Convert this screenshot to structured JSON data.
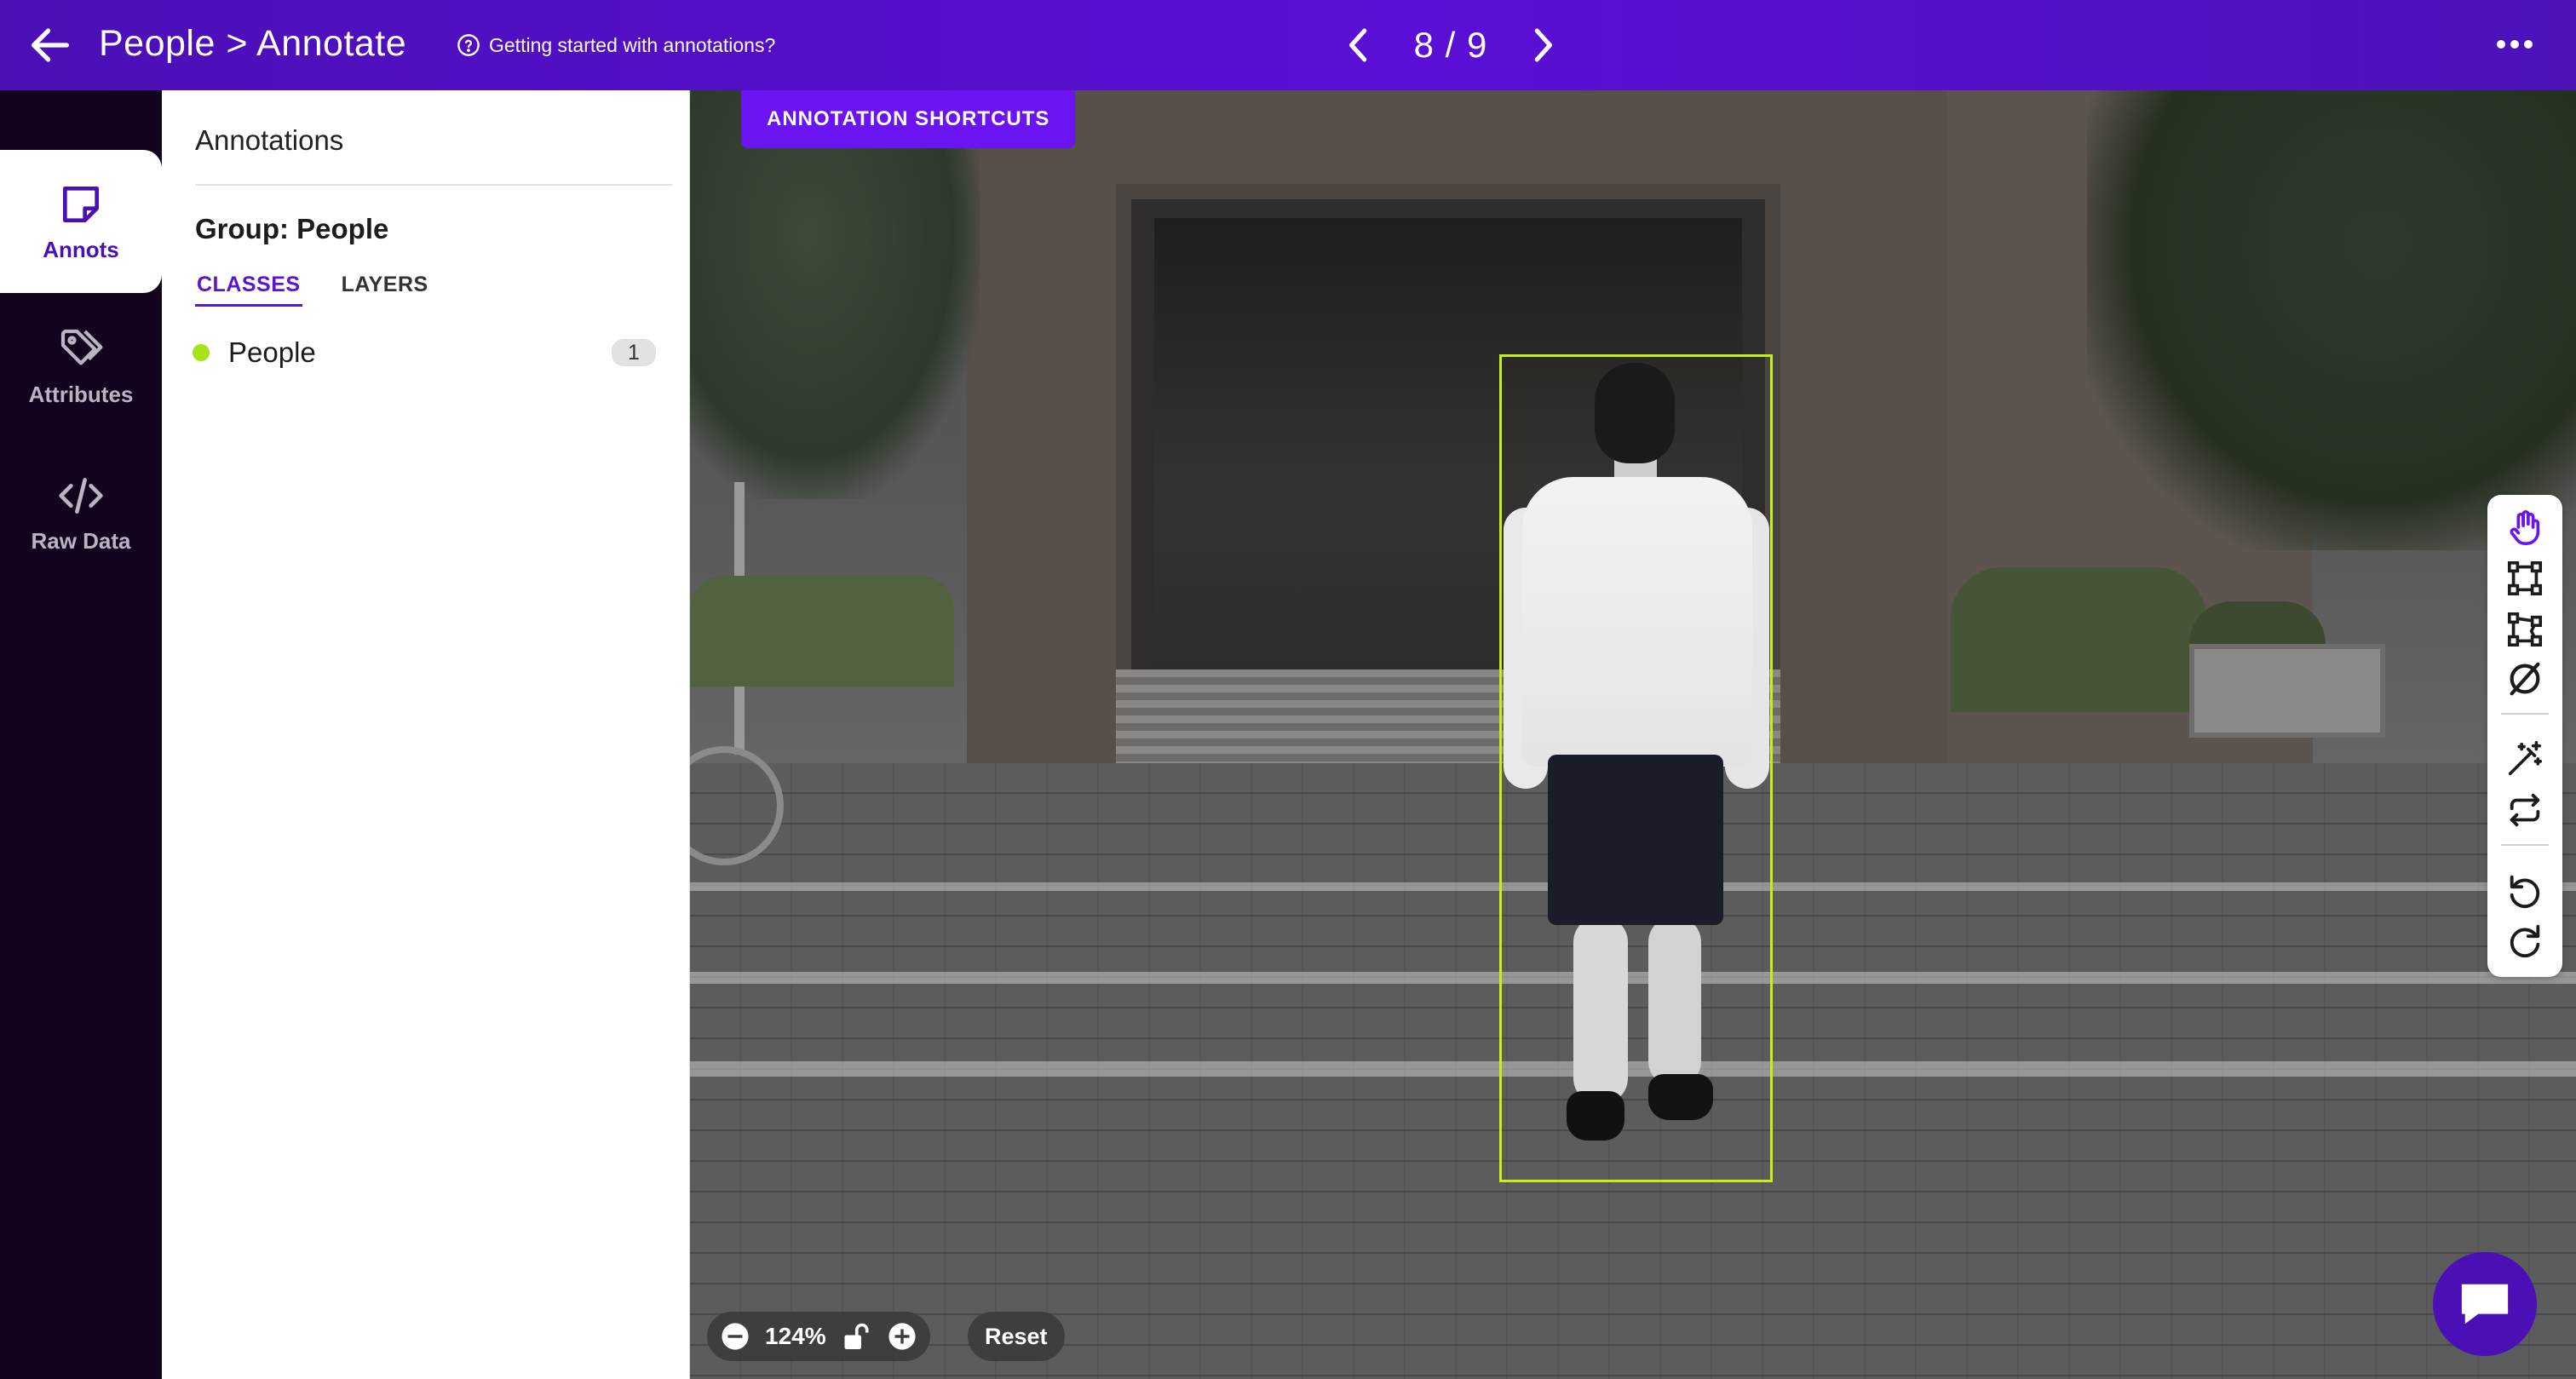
{
  "header": {
    "title": "People > Annotate",
    "help_link": "Getting started with annotations?",
    "pager": "8 / 9",
    "icons": {
      "back": "arrow-left-icon",
      "help": "question-circle-icon",
      "prev": "chevron-left-icon",
      "next": "chevron-right-icon",
      "more": "ellipsis-icon"
    }
  },
  "sidebar": {
    "items": [
      {
        "label": "Annots",
        "icon": "sticky-note-icon",
        "active": true
      },
      {
        "label": "Attributes",
        "icon": "tags-icon",
        "active": false
      },
      {
        "label": "Raw Data",
        "icon": "code-icon",
        "active": false
      }
    ]
  },
  "panel": {
    "title": "Annotations",
    "group_title": "Group: People",
    "tabs": [
      {
        "label": "CLASSES",
        "active": true
      },
      {
        "label": "LAYERS",
        "active": false
      }
    ],
    "classes": [
      {
        "name": "People",
        "count": "1",
        "color": "#a8e319"
      }
    ]
  },
  "canvas": {
    "shortcuts_label": "ANNOTATION SHORTCUTS",
    "bbox_color": "#c6ef17",
    "zoom": "124%",
    "reset_label": "Reset"
  },
  "toolbar": {
    "tools": [
      "hand-icon",
      "bounding-box-icon",
      "polygon-icon",
      "no-object-icon",
      "magic-wand-icon",
      "cycle-icon",
      "undo-icon",
      "redo-icon"
    ],
    "active_tool": "hand-icon"
  },
  "colors": {
    "brand": "#4a0fb5",
    "accent": "#6b14f2",
    "nav_bg": "#13041e"
  }
}
